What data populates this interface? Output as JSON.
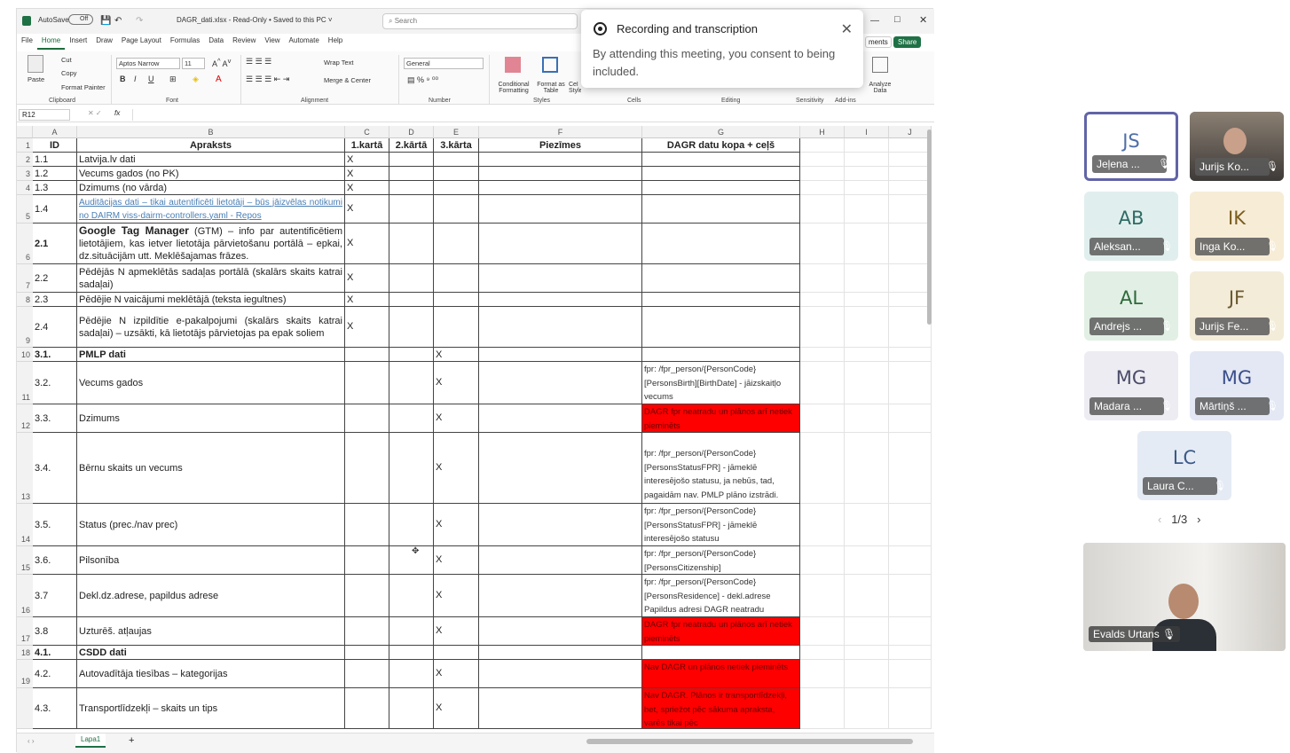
{
  "excel": {
    "autosave_label": "AutoSave",
    "autosave_state": "Off",
    "file_title": "DAGR_dati.xlsx - Read-Only • Saved to this PC ˅",
    "search_placeholder": "Search",
    "menu": [
      "File",
      "Home",
      "Insert",
      "Draw",
      "Page Layout",
      "Formulas",
      "Data",
      "Review",
      "View",
      "Automate",
      "Help"
    ],
    "comments_label": "ments",
    "share_label": "Share",
    "ribbon": {
      "paste": "Paste",
      "cut": "Cut",
      "copy": "Copy",
      "format_painter": "Format Painter",
      "font_name": "Aptos Narrow",
      "font_size": "11",
      "wrap_text": "Wrap Text",
      "merge_center": "Merge & Center",
      "number_format": "General",
      "conditional_formatting": "Conditional Formatting",
      "format_as_table": "Format as Table",
      "cell_styles": "Cel Styles",
      "analyze_data": "Analyze Data",
      "groups": [
        "Clipboard",
        "Font",
        "Alignment",
        "Number",
        "Styles",
        "Cells",
        "Editing",
        "Sensitivity",
        "Add-ins"
      ]
    },
    "name_box": "R12",
    "fx": "fx",
    "columns": [
      "A",
      "B",
      "C",
      "D",
      "E",
      "F",
      "G",
      "H",
      "I",
      "J"
    ],
    "rows": [
      {
        "n": "1",
        "a": "ID",
        "b": "Apraksts",
        "c": "1.kartā",
        "d": "2.kārtā",
        "e": "3.kārta",
        "f": "Piezīmes",
        "g": "DAGR datu kopa + ceļš"
      },
      {
        "n": "2",
        "a": "1.1",
        "b": "Latvija.lv dati",
        "c": "X",
        "d": "",
        "e": "",
        "g": ""
      },
      {
        "n": "3",
        "a": "1.2",
        "b": "Vecums gados (no PK)",
        "c": "X",
        "d": "",
        "e": "",
        "g": ""
      },
      {
        "n": "4",
        "a": "1.3",
        "b": "Dzimums (no vārda)",
        "c": "X",
        "d": "",
        "e": "",
        "g": ""
      },
      {
        "n": "5",
        "a": "1.4",
        "b": "Auditācijas dati – tikai autentificēti lietotāji – būs jāizvēlas notikumi no DAIRM viss-dairm-controllers.yaml - Repos",
        "c": "X",
        "d": "",
        "e": "",
        "g": ""
      },
      {
        "n": "6",
        "a": "2.1",
        "b_bold": "Google Tag Manager",
        "b": " (GTM) – info par autentificētiem lietotājiem, kas ietver lietotāja pārvietošanu portālā – epkai, dz.situācijām utt. Meklēšajamas frāzes.",
        "c": "X",
        "d": "",
        "e": "",
        "g": ""
      },
      {
        "n": "7",
        "a": "2.2",
        "b": "Pēdējās N apmeklētās sadaļas portālā (skalārs skaits katrai sadaļai)",
        "c": "X",
        "d": "",
        "e": "",
        "g": ""
      },
      {
        "n": "8",
        "a": "2.3",
        "b": "Pēdējie N vaicājumi meklētājā (teksta iegultnes)",
        "c": "X",
        "d": "",
        "e": "",
        "g": ""
      },
      {
        "n": "9",
        "a": "2.4",
        "b": "Pēdējie N izpildītie e-pakalpojumi (skalārs skaits katrai sadaļai) – uzsākti, kā lietotājs pārvietojas pa epak soliem",
        "c": "X",
        "d": "",
        "e": "",
        "g": ""
      },
      {
        "n": "10",
        "a": "3.1.",
        "b": "PMLP dati",
        "c": "",
        "d": "",
        "e": "X",
        "g": ""
      },
      {
        "n": "11",
        "a": "3.2.",
        "b": "Vecums gados",
        "c": "",
        "d": "",
        "e": "X",
        "g": "fpr: /fpr_person/{PersonCode}[PersonsBirth][BirthDate] - jāizskaitļo vecums"
      },
      {
        "n": "12",
        "a": "3.3.",
        "b": "Dzimums",
        "c": "",
        "d": "",
        "e": "X",
        "g": "DAGR fpr neatradu un plānos arī netiek pieminēts"
      },
      {
        "n": "13",
        "a": "3.4.",
        "b": "Bērnu skaits un vecums",
        "c": "",
        "d": "",
        "e": "X",
        "g": "fpr: /fpr_person/{PersonCode}[PersonsStatusFPR] - jāmeklē interesējošo statusu, ja nebūs, tad, pagaidām nav. PMLP plāno izstrādi."
      },
      {
        "n": "14",
        "a": "3.5.",
        "b": "Status (prec./nav prec)",
        "c": "",
        "d": "",
        "e": "X",
        "g": "fpr: /fpr_person/{PersonCode}[PersonsStatusFPR] - jāmeklē interesējošo statusu"
      },
      {
        "n": "15",
        "a": "3.6.",
        "b": "Pilsonība",
        "c": "",
        "d": "",
        "e": "X",
        "g": "fpr: /fpr_person/{PersonCode}[PersonsCitizenship]"
      },
      {
        "n": "16",
        "a": "3.7",
        "b": "Dekl.dz.adrese, papildus adrese",
        "c": "",
        "d": "",
        "e": "X",
        "g": "fpr: /fpr_person/{PersonCode}[PersonsResidence] - dekl.adrese Papildus adresi DAGR neatradu"
      },
      {
        "n": "17",
        "a": "3.8",
        "b": "Uzturēš. atļaujas",
        "c": "",
        "d": "",
        "e": "X",
        "g": "DAGR fpr neatradu un plānos arī netiek pieminēts"
      },
      {
        "n": "18",
        "a": "4.1.",
        "b": "CSDD dati",
        "c": "",
        "d": "",
        "e": "",
        "g": ""
      },
      {
        "n": "19",
        "a": "4.2.",
        "b": "Autovadītāja tiesības – kategorijas",
        "c": "",
        "d": "",
        "e": "X",
        "g": "Nav DAGR un plānos netiek pieminēts"
      },
      {
        "n": "",
        "a": "4.3.",
        "b": "Transportlīdzekļi – skaits un tips",
        "c": "",
        "d": "",
        "e": "X",
        "g": "Nav DAGR. Plānos ir transportlīdzekļi, bet, spriežot pēc sākuma apraksta, varēs tikai pēc"
      }
    ],
    "sheet_tab": "Lapa1"
  },
  "notice": {
    "title": "Recording and transcription",
    "body": "By attending this meeting, you consent to being included."
  },
  "teams": {
    "participants": [
      {
        "initials": "JS",
        "name": "Jeļena ...",
        "color": "#4f6fa8",
        "bg": "#e8ecf6"
      },
      {
        "initials": "",
        "name": "Jurijs Ko...",
        "color": "#333",
        "bg": "#6a6a70"
      },
      {
        "initials": "AB",
        "name": "Aleksan...",
        "color": "#2f6b64",
        "bg": "#e0efed"
      },
      {
        "initials": "IK",
        "name": "Inga Ko...",
        "color": "#7a5c1e",
        "bg": "#f7ecd6"
      },
      {
        "initials": "AL",
        "name": "Andrejs ...",
        "color": "#2c6a3a",
        "bg": "#e2efe4"
      },
      {
        "initials": "JF",
        "name": "Jurijs Fe...",
        "color": "#6b5a30",
        "bg": "#f3ecd9"
      },
      {
        "initials": "MG",
        "name": "Madara ...",
        "color": "#4b4b6a",
        "bg": "#ececf2"
      },
      {
        "initials": "MG",
        "name": "Mārtiņš ...",
        "color": "#3b4f8a",
        "bg": "#e3e8f4"
      },
      {
        "initials": "LC",
        "name": "Laura C...",
        "color": "#3b5a8a",
        "bg": "#e5ebf4"
      }
    ],
    "pager": "1/3",
    "self_name": "Evalds Urtans"
  }
}
